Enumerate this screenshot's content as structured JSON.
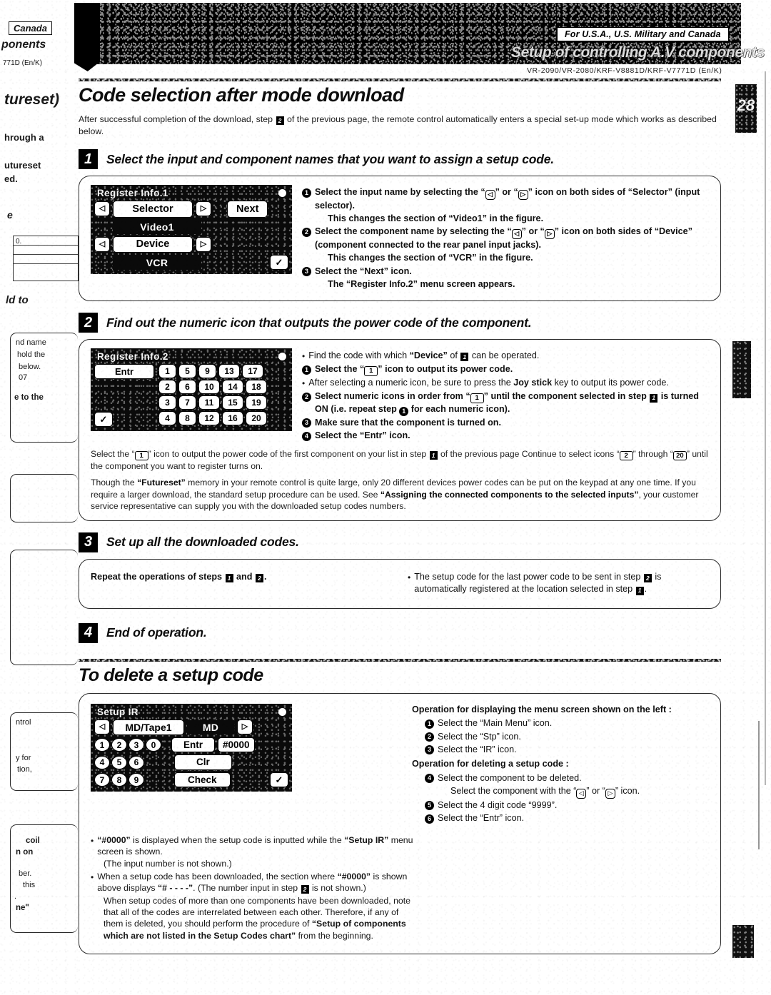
{
  "header": {
    "canada_tab": "Canada",
    "fragment_components": "ponents",
    "fragment_model": "771D (En/K)",
    "usa_notice": "For U.S.A., U.S. Military and Canada",
    "banner_title": "Setup of controlling A.V components",
    "model_line": "VR-2090/VR-2080/KRF-V8881D/KRF-V7771D (En/K)",
    "page_number": "28"
  },
  "left_page_fragments": [
    {
      "text": "tureset)"
    },
    {
      "text": "hrough a"
    },
    {
      "text": "utureset"
    },
    {
      "text": "ed."
    },
    {
      "text": "e"
    },
    {
      "text": "0."
    },
    {
      "text": "ld to"
    },
    {
      "text": "nd name"
    },
    {
      "text": "hold the"
    },
    {
      "text": "below."
    },
    {
      "text": "07"
    },
    {
      "text": "e to the"
    },
    {
      "text": "ntrol"
    },
    {
      "text": "y for"
    },
    {
      "text": "tion,"
    },
    {
      "text": "coil"
    },
    {
      "text": "n on"
    },
    {
      "text": "ber."
    },
    {
      "text": "this"
    },
    {
      "text": "."
    },
    {
      "text": "ne\""
    }
  ],
  "section": {
    "title": "Code selection after mode download",
    "intro_part1": "After successful completion of the download, step ",
    "intro_mark": "2",
    "intro_part2": " of the previous page, the remote control automatically enters a special set-up mode which works as described below."
  },
  "steps": [
    {
      "number": "1",
      "title": "Select the input and component names that you want to assign a setup code.",
      "lcd": {
        "title": "Register Info.1",
        "selector_label": "Selector",
        "selector_value": "Video1",
        "device_label": "Device",
        "device_value": "VCR",
        "next_label": "Next",
        "left_arrow": "◁",
        "right_arrow": "▷",
        "check": "✓"
      },
      "instructions": [
        {
          "mark": "1",
          "bold": true,
          "segments": [
            {
              "t": "Select the input name by selecting the “"
            },
            {
              "k": "◁",
              "arrow": true
            },
            {
              "t": "” or “"
            },
            {
              "k": "▷",
              "arrow": true
            },
            {
              "t": "” icon on both sides of “Selector” (input selector)."
            }
          ]
        },
        {
          "mark": "",
          "bold": true,
          "indent": true,
          "segments": [
            {
              "t": "This changes the section of “Video1” in the figure."
            }
          ]
        },
        {
          "mark": "2",
          "bold": true,
          "segments": [
            {
              "t": "Select the component name by selecting the “"
            },
            {
              "k": "◁",
              "arrow": true
            },
            {
              "t": "” or “"
            },
            {
              "k": "▷",
              "arrow": true
            },
            {
              "t": "” icon on both sides of “Device” (component connected to the rear panel input jacks)."
            }
          ]
        },
        {
          "mark": "",
          "bold": true,
          "indent": true,
          "segments": [
            {
              "t": "This changes the section of “VCR” in the figure."
            }
          ]
        },
        {
          "mark": "3",
          "bold": true,
          "segments": [
            {
              "t": "Select the “Next” icon."
            }
          ]
        },
        {
          "mark": "",
          "bold": true,
          "indent": true,
          "segments": [
            {
              "t": "The “Register Info.2” menu screen appears."
            }
          ]
        }
      ]
    },
    {
      "number": "2",
      "title": "Find out the numeric icon that outputs the power code of the component.",
      "lcd": {
        "title": "Register Info.2",
        "entr_label": "Entr",
        "check": "✓",
        "columns": [
          [
            "1",
            "2",
            "3",
            "4"
          ],
          [
            "5",
            "6",
            "7",
            "8"
          ],
          [
            "9",
            "10",
            "11",
            "12"
          ],
          [
            "13",
            "14",
            "15",
            "16"
          ],
          [
            "17",
            "18",
            "19",
            "20"
          ]
        ]
      },
      "instructions": [
        {
          "bullet": true,
          "segments": [
            {
              "t": "Find the code with which "
            },
            {
              "t": "“Device”",
              "b": true
            },
            {
              "t": " of "
            },
            {
              "sq": "1"
            },
            {
              "t": " can be operated."
            }
          ]
        },
        {
          "mark": "1",
          "bold": true,
          "segments": [
            {
              "t": "Select the “"
            },
            {
              "k": "1"
            },
            {
              "t": "” icon to output its power code."
            }
          ]
        },
        {
          "bullet": true,
          "segments": [
            {
              "t": "After selecting a numeric icon, be sure to press the "
            },
            {
              "t": "Joy stick",
              "b": true
            },
            {
              "t": " key to output its power code."
            }
          ]
        },
        {
          "mark": "2",
          "bold": true,
          "segments": [
            {
              "t": "Select numeric icons in order from “"
            },
            {
              "k": "1"
            },
            {
              "t": "” until the component selected in step "
            },
            {
              "sq": "1"
            },
            {
              "t": " is turned ON (i.e. repeat step "
            },
            {
              "circ": "1"
            },
            {
              "t": " for each numeric icon)."
            }
          ]
        },
        {
          "mark": "3",
          "bold": true,
          "segments": [
            {
              "t": "Make sure that the component is turned on."
            }
          ]
        },
        {
          "mark": "4",
          "bold": true,
          "segments": [
            {
              "t": "Select the “Entr” icon."
            }
          ]
        }
      ],
      "paragraphs": [
        [
          {
            "t": "Select the “"
          },
          {
            "k": "1"
          },
          {
            "t": "” icon to output the power code of the first component on your list in step "
          },
          {
            "sq": "1"
          },
          {
            "t": " of the previous page Continue to select icons “"
          },
          {
            "k": "2"
          },
          {
            "t": "” through “"
          },
          {
            "k": "20"
          },
          {
            "t": "” until the component you want to register turns on."
          }
        ],
        [
          {
            "t": "Though the "
          },
          {
            "t": "“Futureset”",
            "b": true
          },
          {
            "t": " memory in your remote control is quite large, only 20 different devices power codes can be put on the keypad at any one time. If you require a larger download, the standard setup procedure can be used. See "
          },
          {
            "t": "“Assigning the connected components to the selected inputs”",
            "b": true
          },
          {
            "t": ", your customer service representative can supply you with the downloaded setup codes numbers."
          }
        ]
      ]
    },
    {
      "number": "3",
      "title": "Set up all the downloaded codes.",
      "box_left": [
        {
          "t": "Repeat the operations of steps ",
          "b": true
        },
        {
          "sq": "1"
        },
        {
          "t": " and ",
          "b": true
        },
        {
          "sq": "2"
        },
        {
          "t": ".",
          "b": true
        }
      ],
      "box_right": [
        {
          "t": "The setup code for the last power code to be sent in step "
        },
        {
          "sq": "2"
        },
        {
          "t": " is automatically registered at the location selected in step "
        },
        {
          "sq": "1"
        },
        {
          "t": "."
        }
      ]
    },
    {
      "number": "4",
      "title": "End of operation."
    }
  ],
  "delete_section": {
    "title": "To delete a setup code",
    "lcd": {
      "title": "Setup IR",
      "left_arrow": "◁",
      "right_arrow": "▷",
      "source_label": "MD/Tape1",
      "source_value": "MD",
      "code_display": "#0000",
      "entr_label": "Entr",
      "clr_label": "Clr",
      "check_label": "Check",
      "check_icon": "✓",
      "keys_row1": [
        "1",
        "2",
        "3",
        "0"
      ],
      "keys_row2": [
        "4",
        "5",
        "6"
      ],
      "keys_row3": [
        "7",
        "8",
        "9"
      ]
    },
    "right_column": {
      "heading1": "Operation for displaying the menu screen shown on the left :",
      "items1": [
        {
          "mark": "1",
          "segments": [
            {
              "t": "Select the “Main Menu” icon."
            }
          ]
        },
        {
          "mark": "2",
          "segments": [
            {
              "t": "Select the “Stp” icon."
            }
          ]
        },
        {
          "mark": "3",
          "segments": [
            {
              "t": "Select the “IR” icon."
            }
          ]
        }
      ],
      "heading2": "Operation for deleting a setup code :",
      "items2": [
        {
          "mark": "4",
          "segments": [
            {
              "t": "Select the component to be deleted."
            }
          ]
        },
        {
          "mark": "",
          "indent": true,
          "segments": [
            {
              "t": "Select the component with the “"
            },
            {
              "k": "◁",
              "arrow": true
            },
            {
              "t": "” or “"
            },
            {
              "k": "▷",
              "arrow": true
            },
            {
              "t": "” icon."
            }
          ]
        },
        {
          "mark": "5",
          "segments": [
            {
              "t": "Select the 4 digit code “9999”."
            }
          ]
        },
        {
          "mark": "6",
          "segments": [
            {
              "t": "Select the “Entr” icon."
            }
          ]
        }
      ]
    },
    "notes": [
      {
        "bullet": true,
        "segments": [
          {
            "t": "“#0000”",
            "b": true
          },
          {
            "t": " is displayed when the setup code is inputted while the "
          },
          {
            "t": "“Setup IR”",
            "b": true
          },
          {
            "t": " menu screen is shown."
          }
        ]
      },
      {
        "bullet": false,
        "segments": [
          {
            "t": "(The input number is not shown.)"
          }
        ]
      },
      {
        "bullet": true,
        "segments": [
          {
            "t": "When a setup code has been downloaded, the section where "
          },
          {
            "t": "“#0000”",
            "b": true
          },
          {
            "t": " is shown above displays "
          },
          {
            "t": "“# - - - -”",
            "b": true
          },
          {
            "t": ". (The number input in step "
          },
          {
            "sq": "2"
          },
          {
            "t": " is not shown.)"
          }
        ]
      },
      {
        "bullet": false,
        "segments": [
          {
            "t": "When setup codes of more than one components have been downloaded, note that all of the codes are interrelated between each other. Therefore, if any of them is deleted, you should perform the procedure of "
          },
          {
            "t": "“Setup of components which are not listed in the Setup Codes chart”",
            "b": true
          },
          {
            "t": " from the beginning."
          }
        ]
      }
    ]
  }
}
